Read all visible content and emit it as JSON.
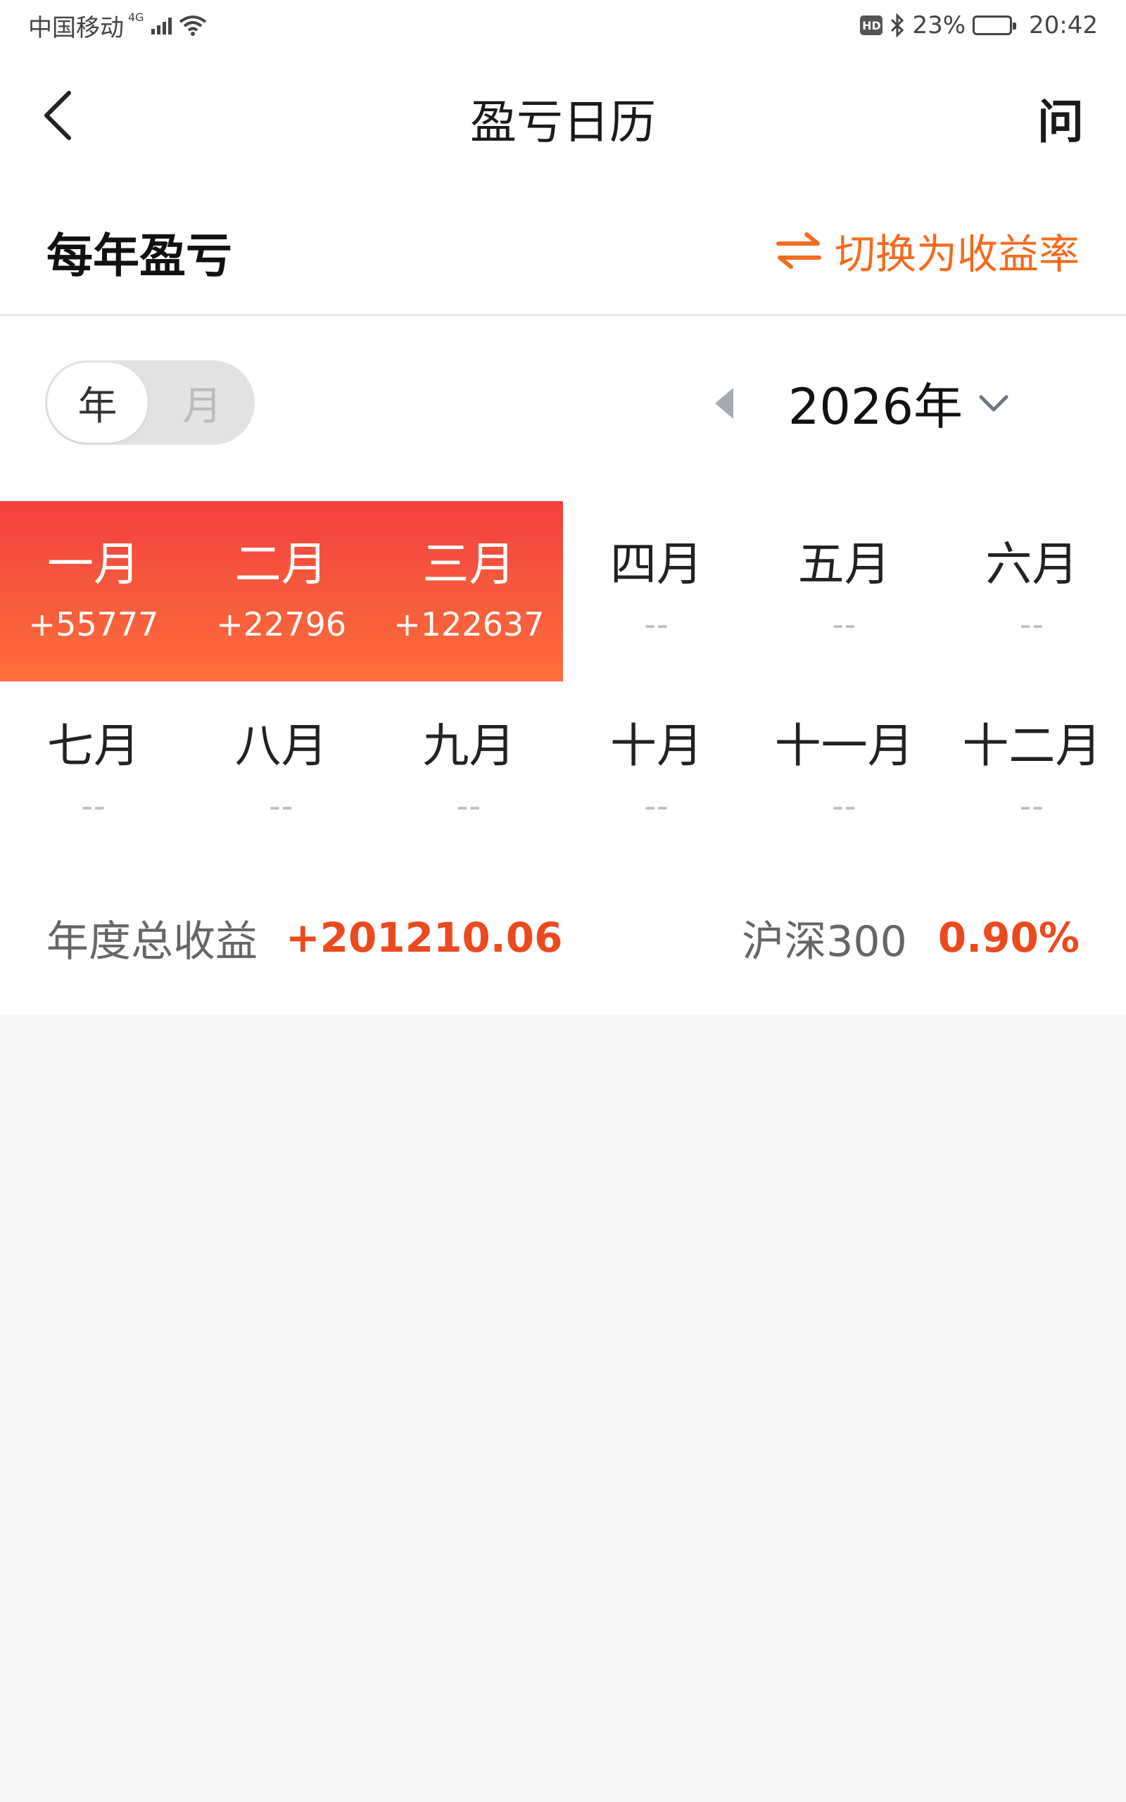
{
  "status_bar": {
    "carrier": "中国移动",
    "network": "4G",
    "hd_badge": "HD",
    "battery_percent": "23%",
    "battery_level": 0.23,
    "time": "20:42"
  },
  "nav": {
    "title": "盈亏日历",
    "help_label": "问"
  },
  "section": {
    "title": "每年盈亏",
    "switch_label": "切换为收益率"
  },
  "toggle": {
    "options": [
      "年",
      "月"
    ],
    "selected": "年"
  },
  "year_selector": {
    "label": "2026年"
  },
  "months": [
    {
      "name": "一月",
      "value": "+55777",
      "highlighted": true
    },
    {
      "name": "二月",
      "value": "+22796",
      "highlighted": true
    },
    {
      "name": "三月",
      "value": "+122637",
      "highlighted": true
    },
    {
      "name": "四月",
      "value": "--",
      "highlighted": false
    },
    {
      "name": "五月",
      "value": "--",
      "highlighted": false
    },
    {
      "name": "六月",
      "value": "--",
      "highlighted": false
    },
    {
      "name": "七月",
      "value": "--",
      "highlighted": false
    },
    {
      "name": "八月",
      "value": "--",
      "highlighted": false
    },
    {
      "name": "九月",
      "value": "--",
      "highlighted": false
    },
    {
      "name": "十月",
      "value": "--",
      "highlighted": false
    },
    {
      "name": "十一月",
      "value": "--",
      "highlighted": false
    },
    {
      "name": "十二月",
      "value": "--",
      "highlighted": false
    }
  ],
  "summary": {
    "total_label": "年度总收益",
    "total_value": "+201210.06",
    "benchmark_label": "沪深300",
    "benchmark_value": "0.90%"
  },
  "colors": {
    "accent_orange": "#f26b1f",
    "profit_red": "#ea4a1e",
    "highlight_gradient_top": "#f43f3f",
    "highlight_gradient_bottom": "#ff6d3c"
  }
}
